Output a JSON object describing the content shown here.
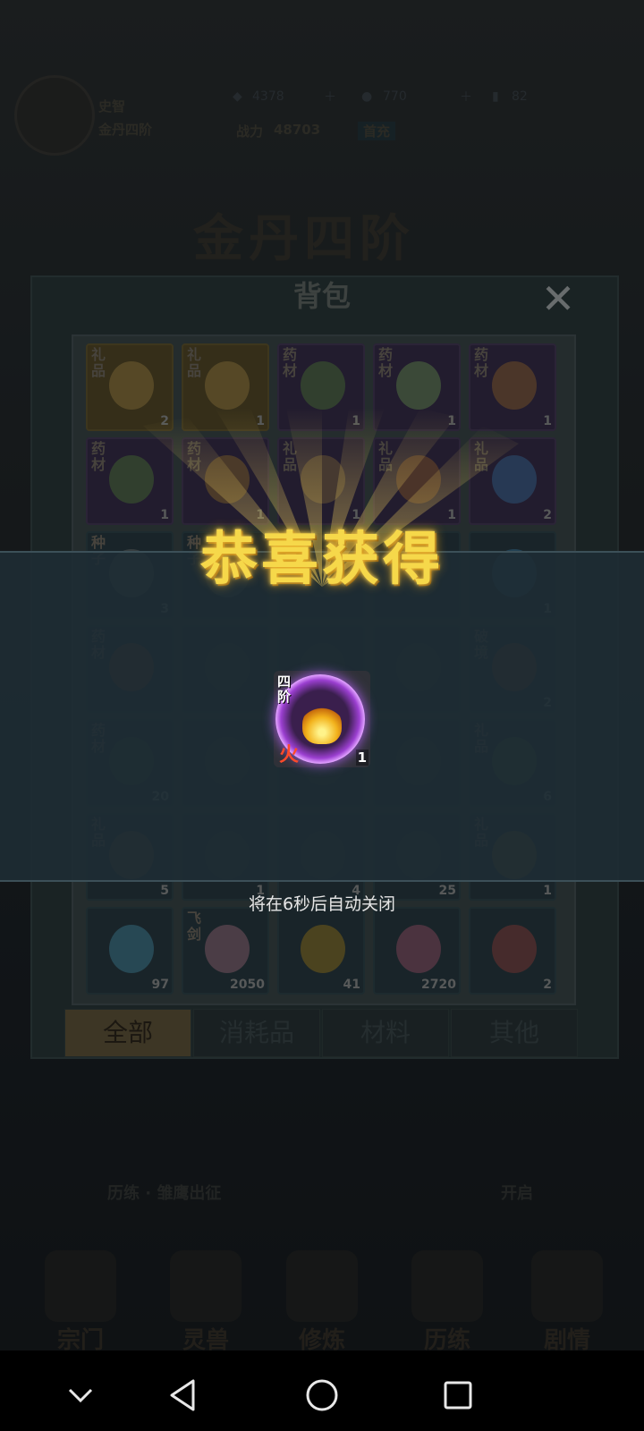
{
  "player": {
    "name": "史智",
    "realm": "金丹四阶",
    "spirit_stones": "4378",
    "jade": "770",
    "energy": "82",
    "combat_power_label": "战力",
    "combat_power": "48703",
    "badge": "首充"
  },
  "realm_banner": "金丹四阶",
  "bag": {
    "title": "背包",
    "items": [
      {
        "tag": "礼品",
        "count": "2",
        "rarity": "gold"
      },
      {
        "tag": "礼品",
        "count": "1",
        "rarity": "gold"
      },
      {
        "tag": "药材",
        "count": "1",
        "rarity": "purple"
      },
      {
        "tag": "药材",
        "count": "1",
        "rarity": "purple"
      },
      {
        "tag": "药材",
        "count": "1",
        "rarity": "purple"
      },
      {
        "tag": "药材",
        "count": "1",
        "rarity": "purple"
      },
      {
        "tag": "药材",
        "count": "1",
        "rarity": "purple"
      },
      {
        "tag": "礼品",
        "count": "1",
        "rarity": "purple"
      },
      {
        "tag": "礼品",
        "count": "1",
        "rarity": "purple"
      },
      {
        "tag": "礼品",
        "count": "2",
        "rarity": "purple"
      },
      {
        "tag": "种子",
        "count": "3",
        "rarity": "teal"
      },
      {
        "tag": "种子",
        "count": "",
        "rarity": "teal"
      },
      {
        "tag": "",
        "count": "",
        "rarity": "teal"
      },
      {
        "tag": "",
        "count": "",
        "rarity": "teal"
      },
      {
        "tag": "",
        "count": "1",
        "rarity": "teal"
      },
      {
        "tag": "药材",
        "count": "",
        "rarity": "teal"
      },
      {
        "tag": "",
        "count": "",
        "rarity": "teal"
      },
      {
        "tag": "",
        "count": "",
        "rarity": "teal"
      },
      {
        "tag": "",
        "count": "",
        "rarity": "teal"
      },
      {
        "tag": "破境",
        "count": "2",
        "rarity": "teal"
      },
      {
        "tag": "药材",
        "count": "20",
        "rarity": "teal"
      },
      {
        "tag": "",
        "count": "",
        "rarity": "teal"
      },
      {
        "tag": "",
        "count": "",
        "rarity": "teal"
      },
      {
        "tag": "",
        "count": "",
        "rarity": "teal"
      },
      {
        "tag": "礼品",
        "count": "6",
        "rarity": "teal"
      },
      {
        "tag": "礼品",
        "count": "5",
        "rarity": "teal"
      },
      {
        "tag": "",
        "count": "1",
        "rarity": "teal"
      },
      {
        "tag": "",
        "count": "4",
        "rarity": "teal"
      },
      {
        "tag": "",
        "count": "25",
        "rarity": "teal"
      },
      {
        "tag": "礼品",
        "count": "1",
        "rarity": "teal"
      },
      {
        "tag": "",
        "count": "97",
        "rarity": "teal"
      },
      {
        "tag": "飞剑",
        "count": "2050",
        "rarity": "teal"
      },
      {
        "tag": "",
        "count": "41",
        "rarity": "teal"
      },
      {
        "tag": "",
        "count": "2720",
        "rarity": "teal"
      },
      {
        "tag": "",
        "count": "2",
        "rarity": "teal"
      }
    ],
    "tabs": [
      "全部",
      "消耗品",
      "材料",
      "其他"
    ]
  },
  "reward_popup": {
    "title": "恭喜获得",
    "item": {
      "tier": "四阶",
      "element": "火",
      "count": "1"
    },
    "auto_close": "将在6秒后自动关闭"
  },
  "quest": {
    "text": "历练 · 雏鹰出征",
    "status": "开启"
  },
  "bottom_nav": [
    "宗门",
    "灵兽",
    "修炼",
    "历练",
    "剧情"
  ],
  "colors": {
    "gold_title": "#f6d84a",
    "purple_ring": "#9b3fd0",
    "tab_active": "#6a5a3a"
  }
}
